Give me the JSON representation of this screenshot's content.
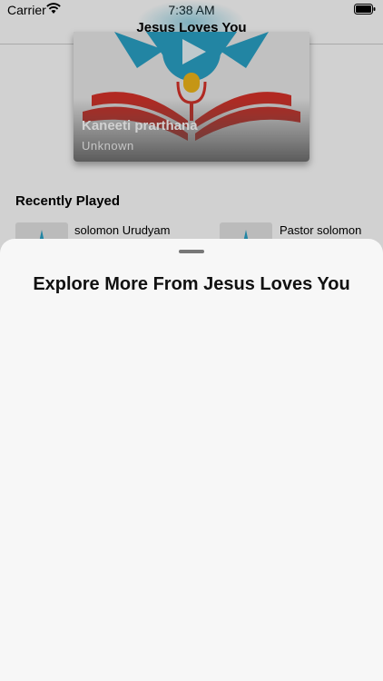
{
  "status_bar": {
    "carrier": "Carrier",
    "time": "7:38 AM"
  },
  "nav": {
    "title": "Jesus Loves You"
  },
  "featured": {
    "title": "Kaneeti prarthana",
    "artist": "Unknown"
  },
  "recently_played": {
    "heading": "Recently Played",
    "items": [
      {
        "title": "solomon Urudyam"
      },
      {
        "title": "Pastor solomon"
      }
    ]
  },
  "sheet": {
    "title": "Explore More From Jesus Loves You"
  },
  "colors": {
    "accent": "#2aa3c7",
    "red": "#d8332a",
    "yellow": "#f1b81a"
  }
}
